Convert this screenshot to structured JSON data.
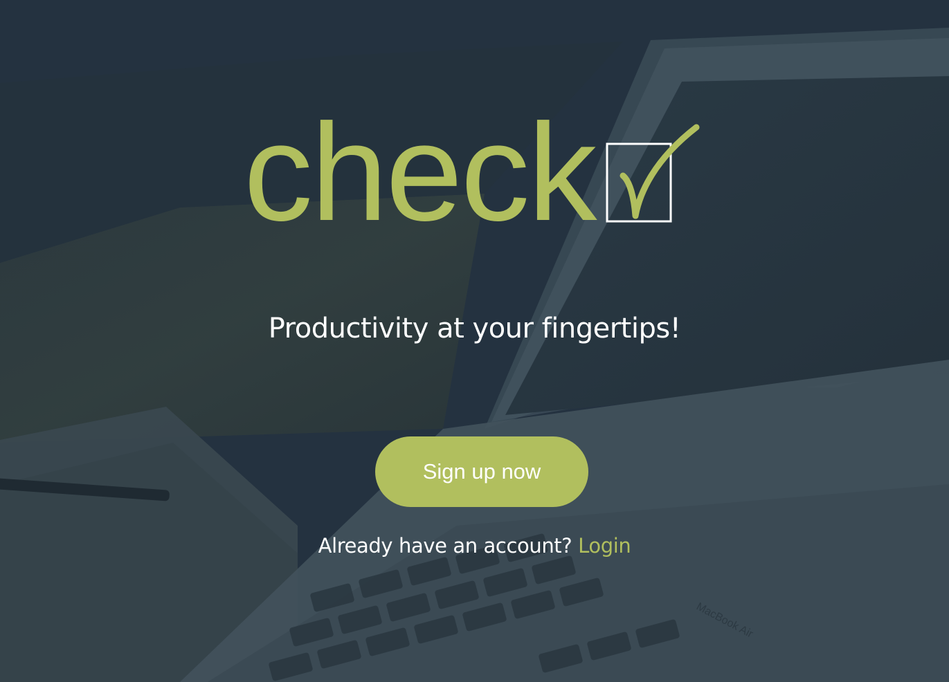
{
  "brand": {
    "logo_text": "check",
    "accent_color": "#b1bf5e",
    "logo_icon": "checkbox-checkmark-icon"
  },
  "hero": {
    "tagline": "Productivity at your fingertips!",
    "background_image": "laptop-and-notebook-desk-photo"
  },
  "actions": {
    "signup_label": "Sign up now",
    "login_prompt": "Already have an account?",
    "login_label": "Login"
  },
  "background_photo": {
    "laptop_badge": "MacBook Air"
  },
  "colors": {
    "overlay": "#263440",
    "text": "#ffffff",
    "accent": "#b1bf5e"
  }
}
